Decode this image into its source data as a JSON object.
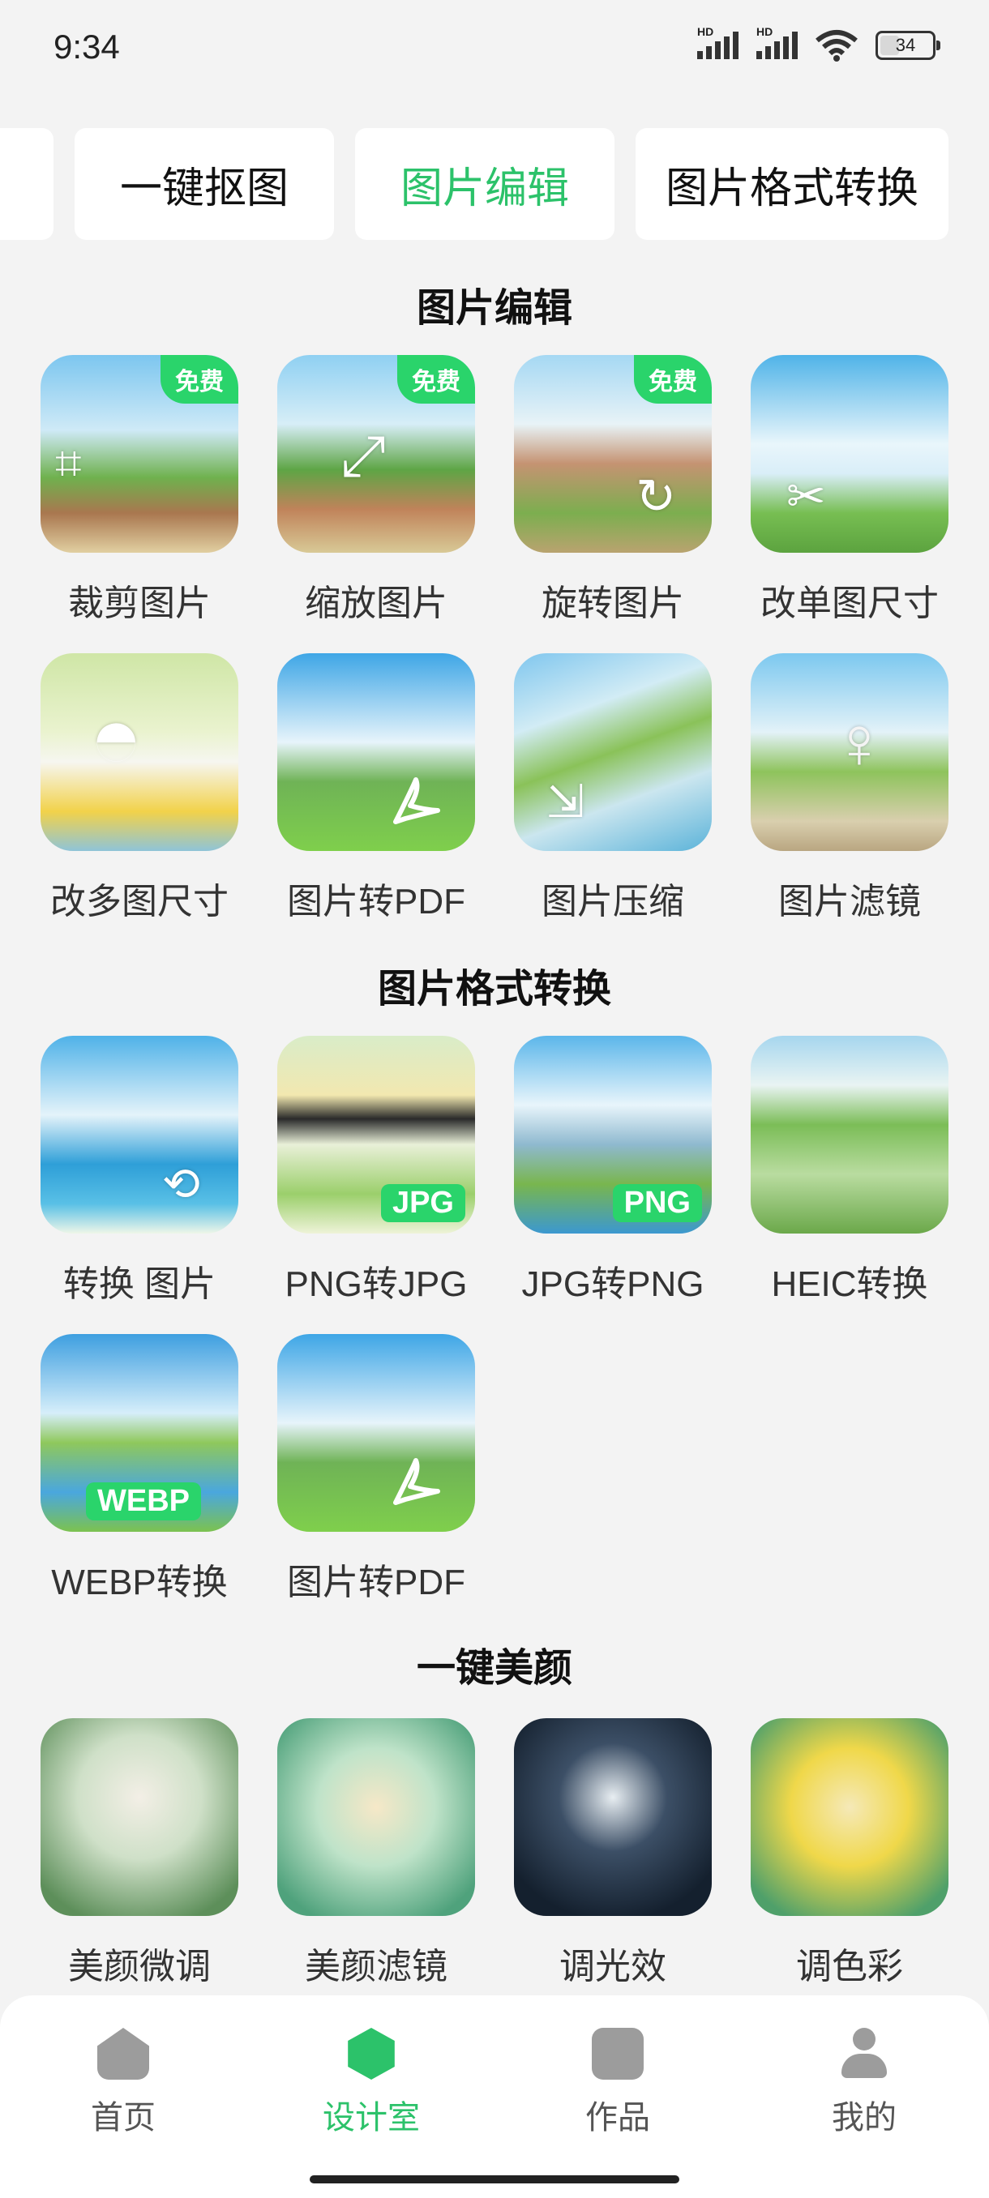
{
  "status_bar": {
    "time": "9:34",
    "battery": "34",
    "signal1_label": "HD",
    "signal2_label": "HD"
  },
  "tabs": [
    {
      "label": "",
      "active": false
    },
    {
      "label": "一键抠图",
      "active": false
    },
    {
      "label": "图片编辑",
      "active": true
    },
    {
      "label": "图片格式转换",
      "active": false
    }
  ],
  "sections": {
    "edit": {
      "title": "图片编辑",
      "items": [
        {
          "label": "裁剪图片",
          "badge": "免费",
          "icon": "crop-icon"
        },
        {
          "label": "缩放图片",
          "badge": "免费",
          "icon": "resize-icon"
        },
        {
          "label": "旋转图片",
          "badge": "免费",
          "icon": "rotate-icon"
        },
        {
          "label": "改单图尺寸",
          "icon": "scissors-icon"
        },
        {
          "label": "改多图尺寸",
          "icon": "duck-image"
        },
        {
          "label": "图片转PDF",
          "icon": "pdf-icon"
        },
        {
          "label": "图片压缩",
          "icon": "compress-icon"
        },
        {
          "label": "图片滤镜",
          "icon": "filter-icon"
        }
      ]
    },
    "format": {
      "title": "图片格式转换",
      "items": [
        {
          "label": "转换      图片",
          "icon": "convert-icon"
        },
        {
          "label": "PNG转JPG",
          "tag": "JPG"
        },
        {
          "label": "JPG转PNG",
          "tag": "PNG"
        },
        {
          "label": "HEIC转换"
        },
        {
          "label": "WEBP转换",
          "tag": "WEBP"
        },
        {
          "label": "图片转PDF",
          "icon": "pdf-icon"
        }
      ]
    },
    "beauty": {
      "title": "一键美颜",
      "items": [
        {
          "label": "美颜微调"
        },
        {
          "label": "美颜滤镜"
        },
        {
          "label": "调光效"
        },
        {
          "label": "调色彩"
        }
      ]
    }
  },
  "bottom_nav": [
    {
      "label": "首页",
      "icon": "home-icon",
      "active": false
    },
    {
      "label": "设计室",
      "icon": "design-icon",
      "active": true
    },
    {
      "label": "作品",
      "icon": "folder-icon",
      "active": false
    },
    {
      "label": "我的",
      "icon": "user-icon",
      "active": false
    }
  ],
  "colors": {
    "accent": "#2cc26a",
    "badge": "#2ad46b",
    "background": "#f3f3f3"
  }
}
